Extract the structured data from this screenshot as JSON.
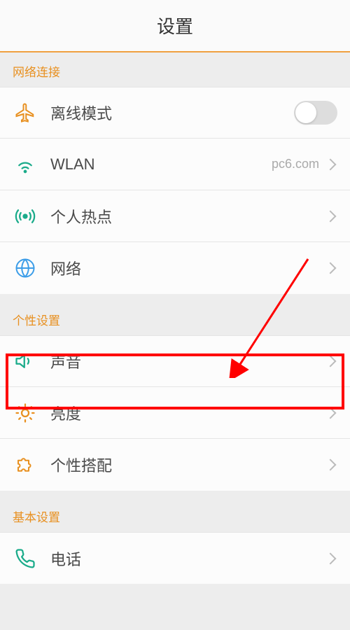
{
  "header": {
    "title": "设置"
  },
  "sections": {
    "network": {
      "header": "网络连接",
      "items": {
        "airplane": {
          "label": "离线模式"
        },
        "wlan": {
          "label": "WLAN",
          "value": "pc6.com"
        },
        "hotspot": {
          "label": "个人热点"
        },
        "net": {
          "label": "网络"
        }
      }
    },
    "personal": {
      "header": "个性设置",
      "items": {
        "sound": {
          "label": "声音"
        },
        "brightness": {
          "label": "亮度"
        },
        "theme": {
          "label": "个性搭配"
        }
      }
    },
    "basic": {
      "header": "基本设置",
      "items": {
        "phone": {
          "label": "电话"
        }
      }
    }
  }
}
